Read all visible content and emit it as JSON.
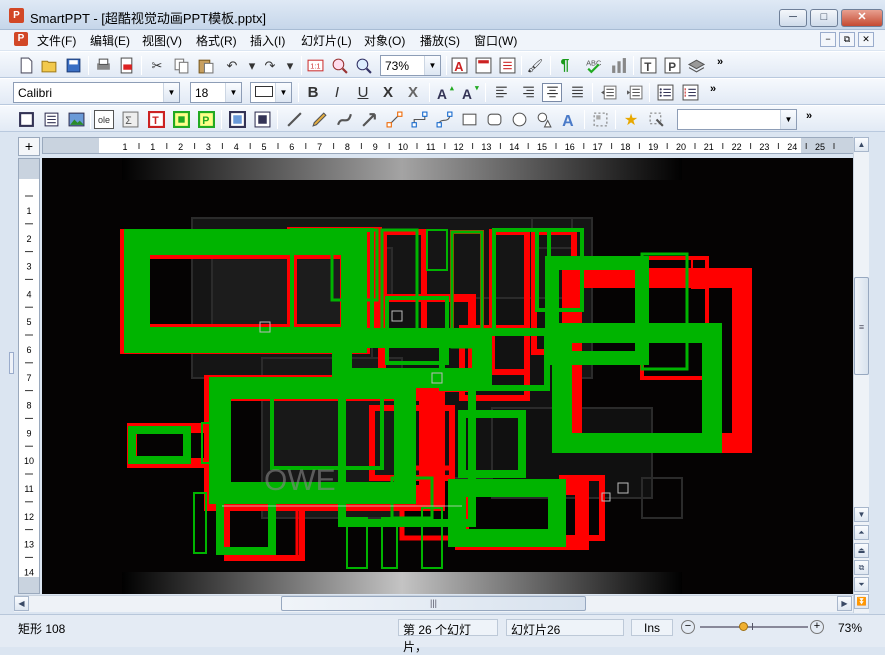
{
  "window": {
    "title": "SmartPPT - [超酷视觉动画PPT模板.pptx]",
    "app_icon_letter": "P",
    "minimize": "─",
    "maximize": "□",
    "close": "✕"
  },
  "menu": [
    "文件(F)",
    "编辑(E)",
    "视图(V)",
    "格式(R)",
    "插入(I)",
    "幻灯片(L)",
    "对象(O)",
    "播放(S)",
    "窗口(W)"
  ],
  "mdi_buttons": [
    "−",
    "⧉",
    "✕"
  ],
  "toolbar1": {
    "zoom_value": "73%",
    "more": "»"
  },
  "toolbar2": {
    "font_name": "Calibri",
    "font_size": "18",
    "bold": "B",
    "italic": "I",
    "underline": "U",
    "strike": "X",
    "shadow": "X",
    "more": "»"
  },
  "toolbar3": {
    "ole_label": "ole",
    "more": "»"
  },
  "ruler": {
    "h_ticks": [
      "1",
      "1",
      "2",
      "3",
      "4",
      "5",
      "6",
      "7",
      "8",
      "9",
      "10",
      "11",
      "12",
      "13",
      "14",
      "15",
      "16",
      "17",
      "18",
      "19",
      "20",
      "21",
      "22",
      "23",
      "24",
      "25"
    ],
    "v_ticks": [
      "1",
      "2",
      "3",
      "4",
      "5",
      "6",
      "7",
      "8",
      "9",
      "10",
      "11",
      "12",
      "13",
      "14"
    ],
    "corner": "+"
  },
  "scroll": {
    "grip": "|||",
    "vgrip": "≡"
  },
  "slide": {
    "faint_text": "OWE"
  },
  "status": {
    "shape": "矩形 108",
    "slide_pos": "第 26 个幻灯片，",
    "slide_name": "幻灯片26",
    "mode": "Ins",
    "zoom": "73%",
    "zoom_level": 0.5
  },
  "colors": {
    "green": "#00b400",
    "red": "#ff0000",
    "canvas_bg": "#050303"
  }
}
